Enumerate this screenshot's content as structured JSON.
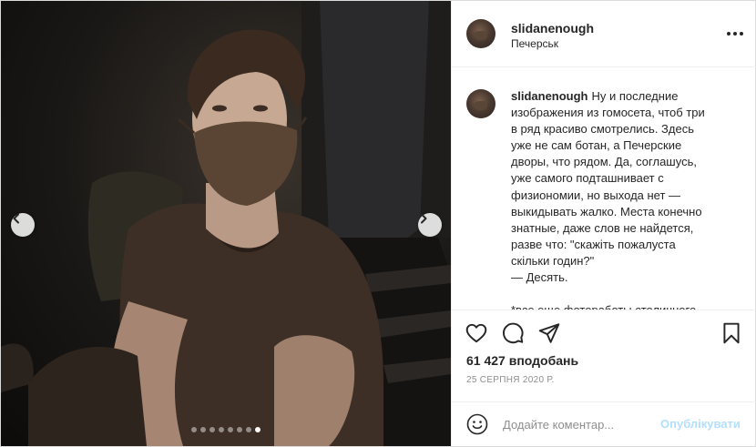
{
  "post": {
    "username": "slidanenough",
    "location": "Печерськ",
    "caption": "Ну и последние изображения из гомосета, чтоб три в ряд красиво смотрелись. Здесь уже не сам ботан, а Печерские дворы, что рядом. Да, соглашусь, уже самого подташнивает с физиономии, но выхода нет — выкидывать жалко. Места конечно знатные, даже слов не найдется, разве что: \"скажіть пожалуста скільки годин?\"\n— Десять.\n\n*все еще фотоработы столичного",
    "likes": "61 427 вподобань",
    "date": "25 СЕРПНЯ 2020 Р.",
    "carousel": {
      "total_slides": 8,
      "active_slide": 8
    }
  },
  "comment": {
    "placeholder": "Додайте коментар...",
    "publish_label": "Опублікувати"
  },
  "icons": {
    "prev": "chevron-left-icon",
    "next": "chevron-right-icon",
    "more": "more-options-icon",
    "like": "heart-icon",
    "comment": "comment-icon",
    "share": "send-icon",
    "save": "bookmark-icon",
    "emoji": "emoji-icon"
  },
  "colors": {
    "publish_disabled": "#b2dffc",
    "secondary_text": "#8e8e8e",
    "border": "#dbdbdb"
  }
}
